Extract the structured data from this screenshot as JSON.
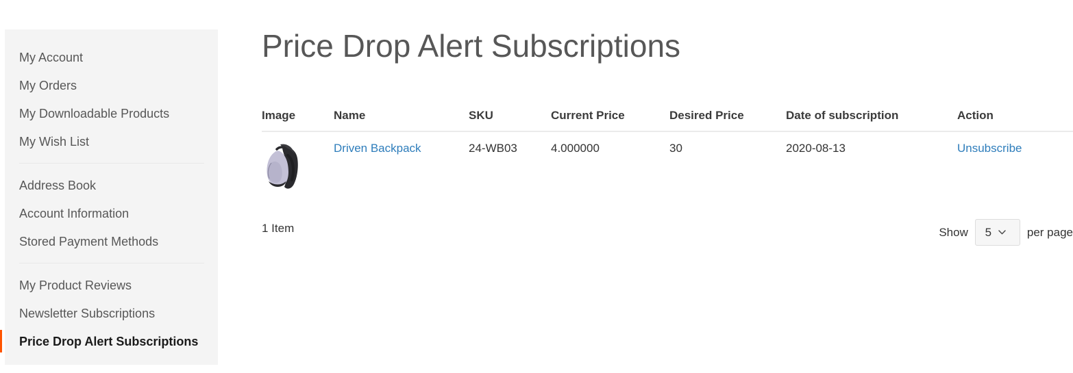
{
  "theme": {
    "accent": "#ff5501",
    "link": "#2e7dbb",
    "sidebar_bg": "#f4f4f4",
    "title_color": "#575757",
    "text_color": "#333333",
    "border_color": "#ebebeb"
  },
  "sidebar": {
    "groups": [
      {
        "items": [
          {
            "label": "My Account",
            "active": false
          },
          {
            "label": "My Orders",
            "active": false
          },
          {
            "label": "My Downloadable Products",
            "active": false
          },
          {
            "label": "My Wish List",
            "active": false
          }
        ]
      },
      {
        "items": [
          {
            "label": "Address Book",
            "active": false
          },
          {
            "label": "Account Information",
            "active": false
          },
          {
            "label": "Stored Payment Methods",
            "active": false
          }
        ]
      },
      {
        "items": [
          {
            "label": "My Product Reviews",
            "active": false
          },
          {
            "label": "Newsletter Subscriptions",
            "active": false
          },
          {
            "label": "Price Drop Alert Subscriptions",
            "active": true
          }
        ]
      }
    ]
  },
  "main": {
    "page_title": "Price Drop Alert Subscriptions",
    "table": {
      "columns": [
        "Image",
        "Name",
        "SKU",
        "Current Price",
        "Desired Price",
        "Date of subscription",
        "Action"
      ],
      "rows": [
        {
          "image_alt": "Driven Backpack",
          "name": "Driven Backpack",
          "sku": "24-WB03",
          "current_price": "4.000000",
          "desired_price": "30",
          "date_of_subscription": "2020-08-13",
          "action": "Unsubscribe"
        }
      ]
    },
    "toolbar": {
      "item_count": "1 Item",
      "show_label": "Show",
      "per_page_value": "5",
      "per_page_label": "per page",
      "chevron_icon": "chevron-down-icon"
    }
  }
}
